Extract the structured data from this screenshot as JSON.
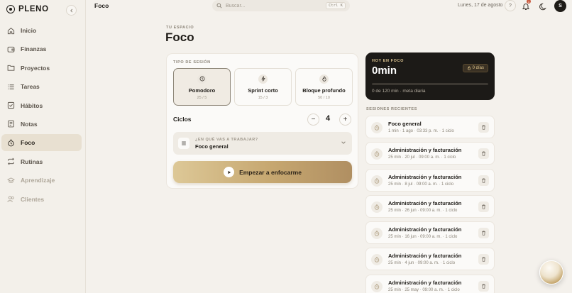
{
  "app": {
    "name": "PLENO"
  },
  "sidebar": {
    "items": [
      {
        "label": "Inicio",
        "icon": "home-icon",
        "state": "normal"
      },
      {
        "label": "Finanzas",
        "icon": "wallet-icon",
        "state": "normal"
      },
      {
        "label": "Proyectos",
        "icon": "folder-icon",
        "state": "normal"
      },
      {
        "label": "Tareas",
        "icon": "list-icon",
        "state": "normal"
      },
      {
        "label": "Hábitos",
        "icon": "check-square-icon",
        "state": "normal"
      },
      {
        "label": "Notas",
        "icon": "note-icon",
        "state": "normal"
      },
      {
        "label": "Foco",
        "icon": "timer-icon",
        "state": "active"
      },
      {
        "label": "Rutinas",
        "icon": "repeat-icon",
        "state": "normal"
      },
      {
        "label": "Aprendizaje",
        "icon": "graduation-icon",
        "state": "muted"
      },
      {
        "label": "Clientes",
        "icon": "users-icon",
        "state": "muted"
      }
    ]
  },
  "topbar": {
    "title": "Foco",
    "search_placeholder": "Buscar...",
    "search_shortcut": "Ctrl K",
    "date": "Lunes, 17 de agosto",
    "help": "?",
    "notification_count": "1",
    "user_initial": "S"
  },
  "header": {
    "eyebrow": "TU ESPACIO",
    "title": "Foco"
  },
  "session_card": {
    "type_label": "TIPO DE SESIÓN",
    "types": [
      {
        "name": "Pomodoro",
        "sub": "25 / 5",
        "icon": "clock-icon",
        "selected": true
      },
      {
        "name": "Sprint corto",
        "sub": "15 / 3",
        "icon": "bolt-icon",
        "selected": false
      },
      {
        "name": "Bloque profundo",
        "sub": "50 / 10",
        "icon": "flame-icon",
        "selected": false
      }
    ],
    "cycles_label": "Ciclos",
    "cycles_value": "4",
    "decrement": "−",
    "increment": "+",
    "task_label": "¿EN QUÉ VAS A TRABAJAR?",
    "task_value": "Foco general",
    "start_label": "Empezar a enfocarme"
  },
  "today": {
    "label": "HOY EN FOCO",
    "value": "0min",
    "streak": "0 días",
    "goal_text": "0 de 120 min · meta diaria",
    "progress_fraction": 0.0
  },
  "recent": {
    "label": "SESIONES RECIENTES",
    "sessions": [
      {
        "title": "Foco general",
        "meta": "1 min · 1 ago · 03:33 p. m. · 1 ciclo"
      },
      {
        "title": "Administración y facturación",
        "meta": "25 min · 20 jul · 09:00 a. m. · 1 ciclo"
      },
      {
        "title": "Administración y facturación",
        "meta": "25 min · 8 jul · 09:00 a. m. · 1 ciclo"
      },
      {
        "title": "Administración y facturación",
        "meta": "25 min · 26 jun · 09:00 a. m. · 1 ciclo"
      },
      {
        "title": "Administración y facturación",
        "meta": "25 min · 16 jun · 09:00 a. m. · 1 ciclo"
      },
      {
        "title": "Administración y facturación",
        "meta": "25 min · 4 jun · 09:00 a. m. · 1 ciclo"
      },
      {
        "title": "Administración y facturación",
        "meta": "25 min · 25 may · 09:00 a. m. · 1 ciclo"
      }
    ]
  },
  "colors": {
    "accent_gold": "#c6a770",
    "dark_card": "#1c1a17",
    "active_nav": "#e8e0d1"
  }
}
